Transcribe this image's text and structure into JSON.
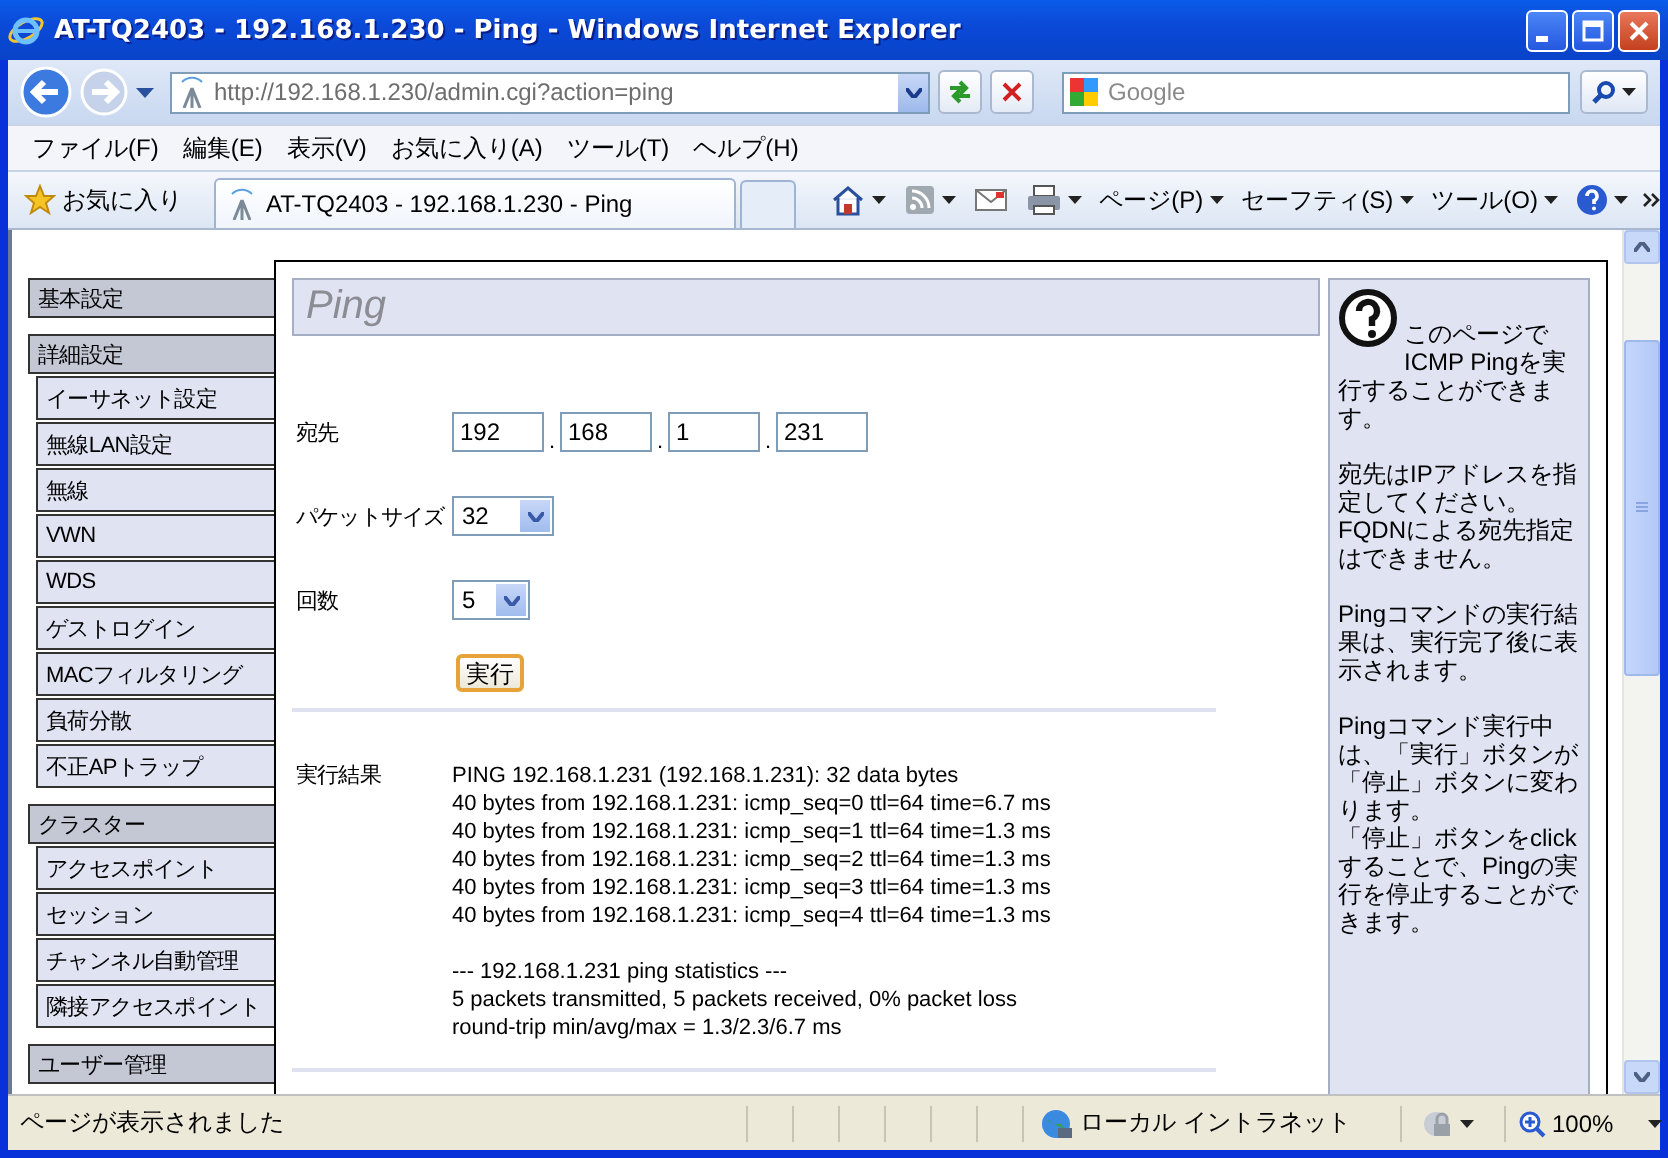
{
  "window": {
    "title": "AT-TQ2403 - 192.168.1.230 - Ping - Windows Internet Explorer"
  },
  "address_bar": {
    "url": "http://192.168.1.230/admin.cgi?action=ping"
  },
  "search": {
    "placeholder": "Google"
  },
  "menu": [
    "ファイル(F)",
    "編集(E)",
    "表示(V)",
    "お気に入り(A)",
    "ツール(T)",
    "ヘルプ(H)"
  ],
  "favorites": {
    "label": "お気に入り"
  },
  "tabs": [
    {
      "label": "AT-TQ2403 - 192.168.1.230 - Ping",
      "selected": true
    }
  ],
  "command_bar": [
    "ページ(P)",
    "セーフティ(S)",
    "ツール(O)"
  ],
  "sidebar": {
    "groups": [
      {
        "label": "基本設定"
      },
      {
        "label": "詳細設定",
        "children": [
          {
            "label": "イーサネット設定"
          },
          {
            "label": "無線LAN設定"
          },
          {
            "label": "無線"
          },
          {
            "label": "VWN"
          },
          {
            "label": "WDS"
          },
          {
            "label": "ゲストログイン"
          },
          {
            "label": "MACフィルタリング"
          },
          {
            "label": "負荷分散"
          },
          {
            "label": "不正APトラップ"
          }
        ]
      },
      {
        "label": "クラスター",
        "children": [
          {
            "label": "アクセスポイント"
          },
          {
            "label": "セッション"
          },
          {
            "label": "チャンネル自動管理"
          },
          {
            "label": "隣接アクセスポイント"
          }
        ]
      },
      {
        "label": "ユーザー管理"
      }
    ]
  },
  "page": {
    "title": "Ping",
    "destination": {
      "label": "宛先",
      "octets": [
        "192",
        "168",
        "1",
        "231"
      ],
      "separator": "."
    },
    "packet_size": {
      "label": "パケットサイズ",
      "value": "32"
    },
    "count": {
      "label": "回数",
      "value": "5"
    },
    "run_button": "実行",
    "result": {
      "label": "実行結果",
      "lines": [
        "PING 192.168.1.231 (192.168.1.231): 32 data bytes",
        "40 bytes from 192.168.1.231: icmp_seq=0 ttl=64 time=6.7 ms",
        "40 bytes from 192.168.1.231: icmp_seq=1 ttl=64 time=1.3 ms",
        "40 bytes from 192.168.1.231: icmp_seq=2 ttl=64 time=1.3 ms",
        "40 bytes from 192.168.1.231: icmp_seq=3 ttl=64 time=1.3 ms",
        "40 bytes from 192.168.1.231: icmp_seq=4 ttl=64 time=1.3 ms"
      ],
      "statistics": [
        "--- 192.168.1.231 ping statistics ---",
        "5 packets transmitted, 5 packets received, 0% packet loss",
        "round-trip min/avg/max = 1.3/2.3/6.7 ms"
      ]
    }
  },
  "help": {
    "paragraphs": [
      [
        "このページでICMP Pingを実行することができます。"
      ],
      [
        "宛先はIPアドレスを指定してください。FQDNによる宛先指定はできません。"
      ],
      [
        "Pingコマンドの実行結果は、実行完了後に表示されます。"
      ],
      [
        "Pingコマンド実行中は、「実行」ボタンが「停止」ボタンに変わります。",
        "「停止」ボタンをclickすることで、Pingの実行を停止することができます。"
      ]
    ]
  },
  "status_bar": {
    "text": "ページが表示されました",
    "zone": "ローカル イントラネット",
    "zoom": "100%"
  }
}
